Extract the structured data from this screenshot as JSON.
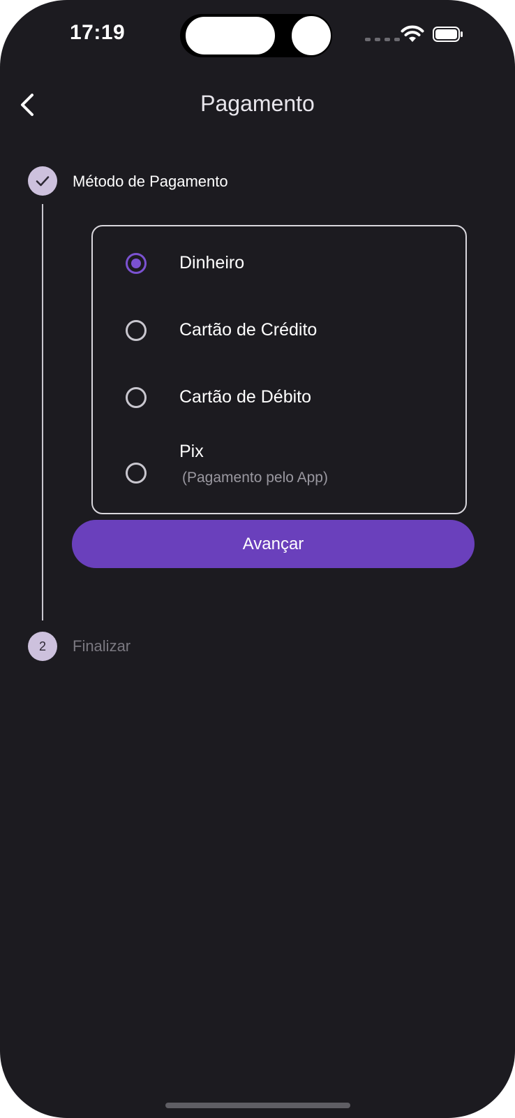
{
  "status_bar": {
    "time": "17:19"
  },
  "header": {
    "title": "Pagamento",
    "back_icon": "chevron-left-icon"
  },
  "stepper": {
    "steps": [
      {
        "number": "",
        "label": "Método de Pagamento",
        "state": "completed"
      },
      {
        "number": "2",
        "label": "Finalizar",
        "state": "pending"
      }
    ]
  },
  "payment_options": [
    {
      "label": "Dinheiro",
      "sublabel": "",
      "selected": true
    },
    {
      "label": "Cartão de Crédito",
      "sublabel": "",
      "selected": false
    },
    {
      "label": "Cartão de Débito",
      "sublabel": "",
      "selected": false
    },
    {
      "label": "Pix",
      "sublabel": "(Pagamento pelo App)",
      "selected": false
    }
  ],
  "actions": {
    "advance_label": "Avançar"
  },
  "colors": {
    "background": "#1c1b20",
    "accent": "#6a40bc",
    "radio_selected": "#7b52d1",
    "step_circle": "#cdc1dd"
  }
}
